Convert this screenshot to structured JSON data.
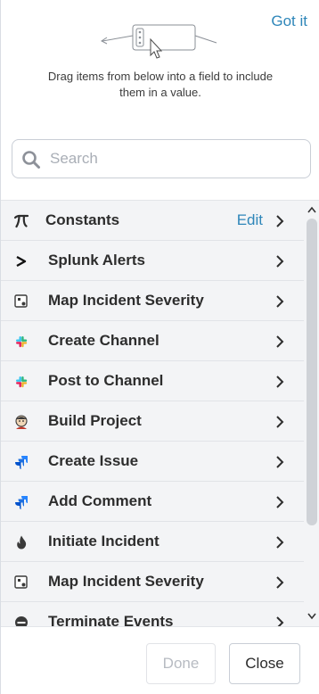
{
  "hint": {
    "got_it_label": "Got it",
    "text": "Drag items from below into a field to include them in a value."
  },
  "search": {
    "placeholder": "Search",
    "value": ""
  },
  "list": {
    "items": [
      {
        "label": "Constants",
        "icon": "pi-icon",
        "action": "Edit"
      },
      {
        "label": "Splunk Alerts",
        "icon": "greater-than-icon"
      },
      {
        "label": "Map Incident Severity",
        "icon": "map-severity-icon"
      },
      {
        "label": "Create Channel",
        "icon": "slack-icon"
      },
      {
        "label": "Post to Channel",
        "icon": "slack-icon"
      },
      {
        "label": "Build Project",
        "icon": "jenkins-icon"
      },
      {
        "label": "Create Issue",
        "icon": "jira-icon"
      },
      {
        "label": "Add Comment",
        "icon": "jira-icon"
      },
      {
        "label": "Initiate Incident",
        "icon": "flame-icon"
      },
      {
        "label": "Map Incident Severity",
        "icon": "map-severity-icon"
      },
      {
        "label": "Terminate Events",
        "icon": "terminate-icon"
      }
    ]
  },
  "footer": {
    "done_label": "Done",
    "close_label": "Close"
  },
  "colors": {
    "accent": "#2e86b9",
    "list_background": "#f3f4f6",
    "slack": [
      "#36c5f0",
      "#2eb67d",
      "#ecb22e",
      "#e01e5a"
    ],
    "jira": "#2684ff"
  }
}
